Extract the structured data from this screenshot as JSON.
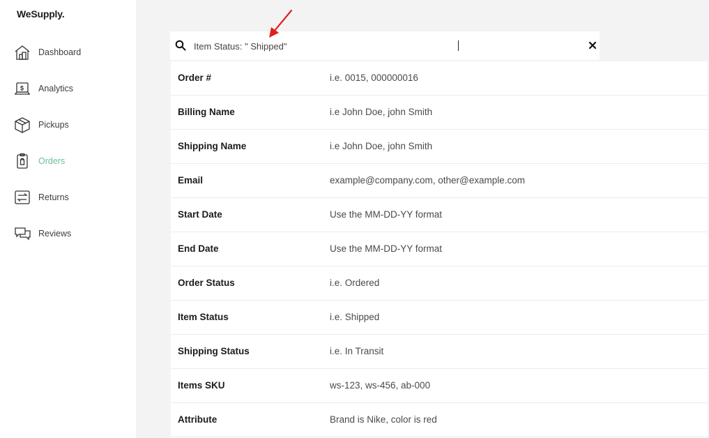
{
  "app": {
    "logo": "WeSupply."
  },
  "sidebar": {
    "items": [
      {
        "label": "Dashboard",
        "icon": "dashboard-icon",
        "active": false
      },
      {
        "label": "Analytics",
        "icon": "analytics-icon",
        "active": false
      },
      {
        "label": "Pickups",
        "icon": "pickups-icon",
        "active": false
      },
      {
        "label": "Orders",
        "icon": "orders-icon",
        "active": true
      },
      {
        "label": "Returns",
        "icon": "returns-icon",
        "active": false
      },
      {
        "label": "Reviews",
        "icon": "reviews-icon",
        "active": false
      }
    ]
  },
  "search": {
    "value": "Item Status: \" Shipped\"",
    "icon": "search-icon",
    "clear_icon": "close-icon"
  },
  "filters": [
    {
      "label": "Order #",
      "example": "i.e. 0015, 000000016"
    },
    {
      "label": "Billing Name",
      "example": "i.e John Doe, john Smith"
    },
    {
      "label": "Shipping Name",
      "example": "i.e John Doe, john Smith"
    },
    {
      "label": "Email",
      "example": "example@company.com, other@example.com"
    },
    {
      "label": "Start Date",
      "example": "Use the MM-DD-YY format"
    },
    {
      "label": "End Date",
      "example": "Use the MM-DD-YY format"
    },
    {
      "label": "Order Status",
      "example": "i.e. Ordered"
    },
    {
      "label": "Item Status",
      "example": "i.e. Shipped"
    },
    {
      "label": "Shipping Status",
      "example": "i.e. In Transit"
    },
    {
      "label": "Items SKU",
      "example": "ws-123, ws-456, ab-000"
    },
    {
      "label": "Attribute",
      "example": "Brand is Nike, color is red"
    }
  ],
  "colors": {
    "accent": "#6dbf9a",
    "annotation": "#e02020",
    "background": "#f3f3f4"
  }
}
